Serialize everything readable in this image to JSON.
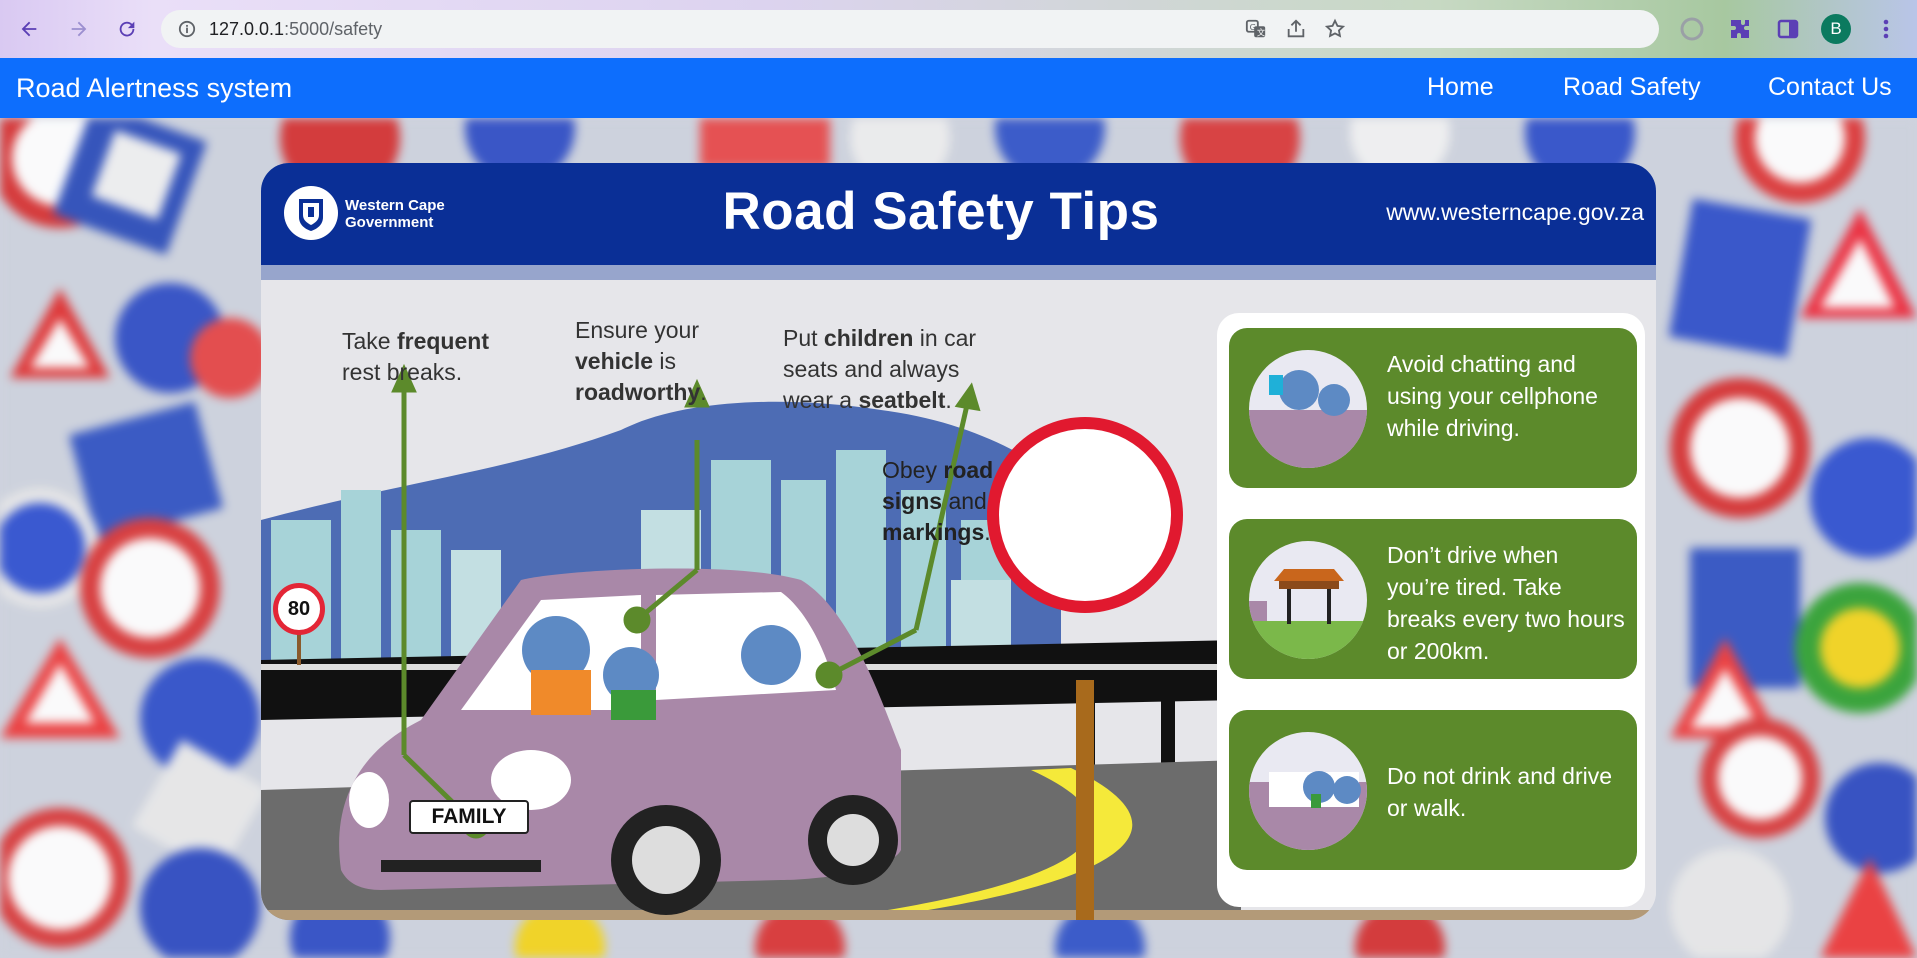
{
  "browser": {
    "url_host": "127.0.0.1",
    "url_path": ":5000/safety",
    "profile_initial": "B"
  },
  "navbar": {
    "brand": "Road Alertness system",
    "links": [
      "Home",
      "Road Safety",
      "Contact Us"
    ]
  },
  "poster": {
    "org_line1": "Western Cape",
    "org_line2": "Government",
    "title": "Road Safety Tips",
    "website": "www.westerncape.gov.za",
    "tip_rest_pre": "Take ",
    "tip_rest_bold": "frequent",
    "tip_rest_post": "rest breaks.",
    "tip_vehicle_pre": "Ensure your",
    "tip_vehicle_bold1": "vehicle",
    "tip_vehicle_mid": " is",
    "tip_vehicle_bold2": "roadworthy",
    "tip_vehicle_post": ".",
    "tip_children_pre": "Put ",
    "tip_children_bold1": "children",
    "tip_children_mid1": " in car",
    "tip_children_mid2": "seats and always",
    "tip_children_mid3": "wear a ",
    "tip_children_bold2": "seatbelt",
    "tip_children_post": ".",
    "sign_pre": "Obey ",
    "sign_bold1": "road",
    "sign_bold2": "signs",
    "sign_mid": " and",
    "sign_bold3": "markings",
    "sign_post": ".",
    "speed_limit": "80",
    "plate": "FAMILY",
    "cards": [
      "Avoid chatting and using your cellphone while driving.",
      "Don’t drive when you’re tired. Take breaks every two hours or 200km.",
      "Do not drink and drive or walk."
    ]
  },
  "colors": {
    "navbar": "#0d6efd",
    "poster_header": "#0a2f96",
    "card_green": "#5c8a2b",
    "car": "#a988a8"
  }
}
